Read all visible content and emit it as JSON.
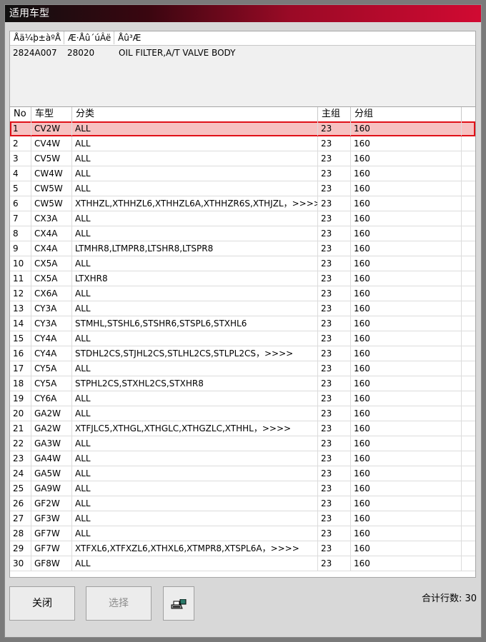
{
  "window": {
    "title": "适用车型"
  },
  "top_list": {
    "headers": [
      "Åä¼þ±àºÅ",
      "Æ·Åû´úÂë",
      "Åû³Æ"
    ],
    "row": [
      "2824A007",
      "28020",
      "OIL FILTER,A/T VALVE BODY"
    ]
  },
  "grid": {
    "headers": [
      "No",
      "车型",
      "分类",
      "主组",
      "分组"
    ],
    "rows": [
      [
        "1",
        "CV2W",
        "ALL",
        "23",
        "160"
      ],
      [
        "2",
        "CV4W",
        "ALL",
        "23",
        "160"
      ],
      [
        "3",
        "CV5W",
        "ALL",
        "23",
        "160"
      ],
      [
        "4",
        "CW4W",
        "ALL",
        "23",
        "160"
      ],
      [
        "5",
        "CW5W",
        "ALL",
        "23",
        "160"
      ],
      [
        "6",
        "CW5W",
        "XTHHZL,XTHHZL6,XTHHZL6A,XTHHZR6S,XTHJZL，>>>>",
        "23",
        "160"
      ],
      [
        "7",
        "CX3A",
        "ALL",
        "23",
        "160"
      ],
      [
        "8",
        "CX4A",
        "ALL",
        "23",
        "160"
      ],
      [
        "9",
        "CX4A",
        "LTMHR8,LTMPR8,LTSHR8,LTSPR8",
        "23",
        "160"
      ],
      [
        "10",
        "CX5A",
        "ALL",
        "23",
        "160"
      ],
      [
        "11",
        "CX5A",
        "LTXHR8",
        "23",
        "160"
      ],
      [
        "12",
        "CX6A",
        "ALL",
        "23",
        "160"
      ],
      [
        "13",
        "CY3A",
        "ALL",
        "23",
        "160"
      ],
      [
        "14",
        "CY3A",
        "STMHL,STSHL6,STSHR6,STSPL6,STXHL6",
        "23",
        "160"
      ],
      [
        "15",
        "CY4A",
        "ALL",
        "23",
        "160"
      ],
      [
        "16",
        "CY4A",
        "STDHL2CS,STJHL2CS,STLHL2CS,STLPL2CS，>>>>",
        "23",
        "160"
      ],
      [
        "17",
        "CY5A",
        "ALL",
        "23",
        "160"
      ],
      [
        "18",
        "CY5A",
        "STPHL2CS,STXHL2CS,STXHR8",
        "23",
        "160"
      ],
      [
        "19",
        "CY6A",
        "ALL",
        "23",
        "160"
      ],
      [
        "20",
        "GA2W",
        "ALL",
        "23",
        "160"
      ],
      [
        "21",
        "GA2W",
        "XTFJLC5,XTHGL,XTHGLC,XTHGZLC,XTHHL，>>>>",
        "23",
        "160"
      ],
      [
        "22",
        "GA3W",
        "ALL",
        "23",
        "160"
      ],
      [
        "23",
        "GA4W",
        "ALL",
        "23",
        "160"
      ],
      [
        "24",
        "GA5W",
        "ALL",
        "23",
        "160"
      ],
      [
        "25",
        "GA9W",
        "ALL",
        "23",
        "160"
      ],
      [
        "26",
        "GF2W",
        "ALL",
        "23",
        "160"
      ],
      [
        "27",
        "GF3W",
        "ALL",
        "23",
        "160"
      ],
      [
        "28",
        "GF7W",
        "ALL",
        "23",
        "160"
      ],
      [
        "29",
        "GF7W",
        "XTFXL6,XTFXZL6,XTHXL6,XTMPR8,XTSPL6A，>>>>",
        "23",
        "160"
      ],
      [
        "30",
        "GF8W",
        "ALL",
        "23",
        "160"
      ]
    ],
    "selected_index": 0
  },
  "footer": {
    "close_label": "关闭",
    "select_label": "选择",
    "print_icon": "printer-icon",
    "total_text": "合计行数: 30"
  },
  "colors": {
    "title_accent": "#d10a32",
    "selection_bg": "#f7c1c1",
    "selection_border": "#e01018"
  }
}
